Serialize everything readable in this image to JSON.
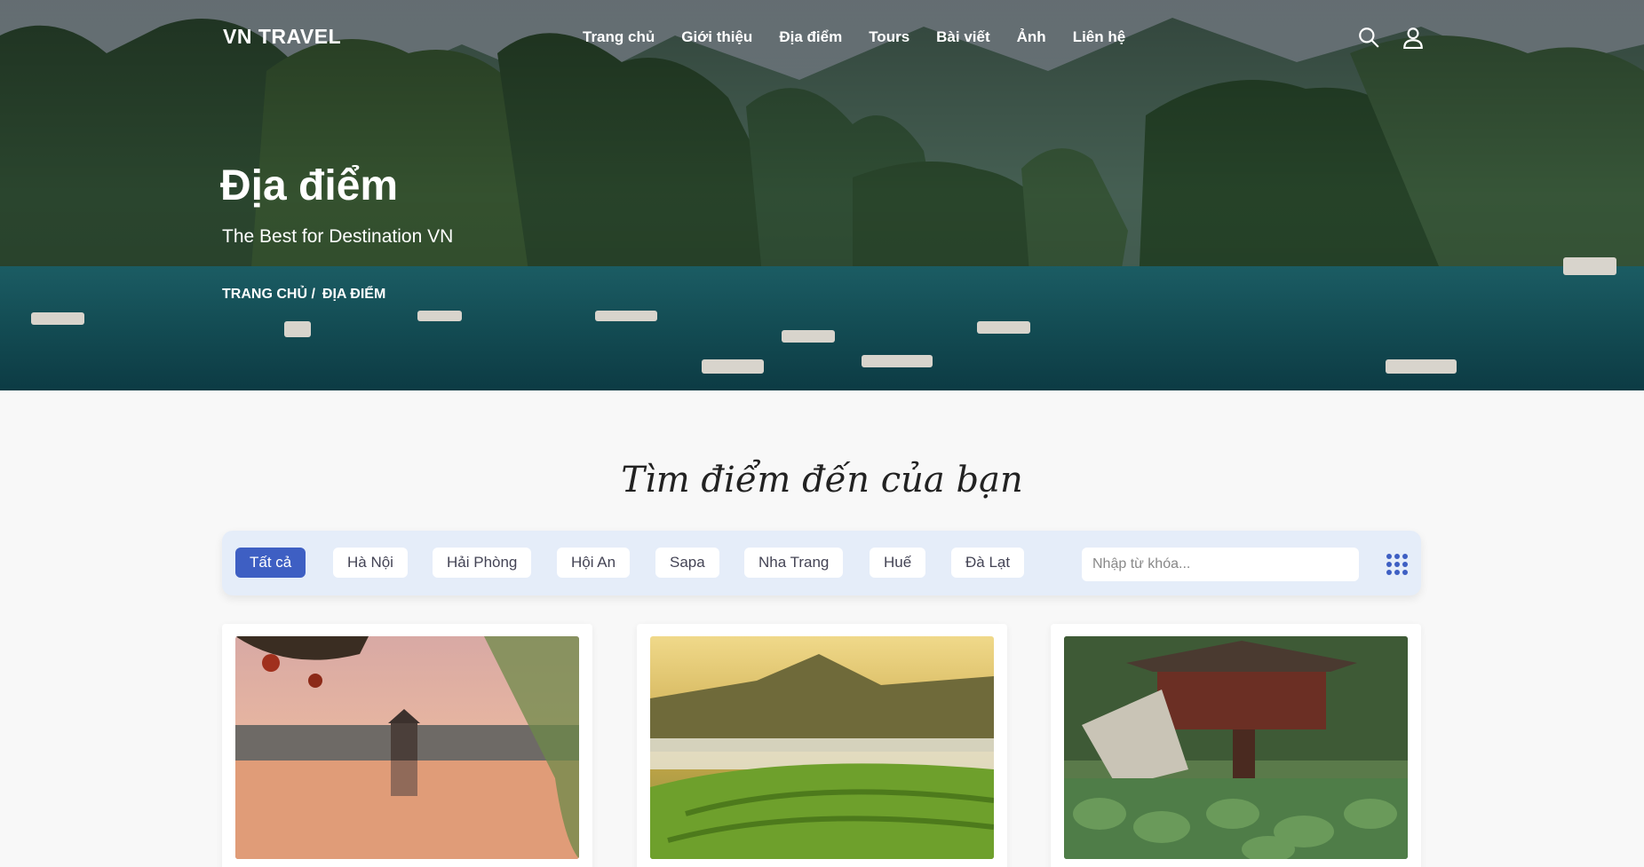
{
  "header": {
    "logo": "VN TRAVEL",
    "menu": [
      "Trang chủ",
      "Giới thiệu",
      "Địa điểm",
      "Tours",
      "Bài viết",
      "Ảnh",
      "Liên hệ"
    ],
    "icons": [
      "search-icon",
      "user-icon"
    ]
  },
  "hero": {
    "title": "Địa điểm",
    "subtitle": "The Best for Destination VN",
    "breadcrumb": [
      "TRANG CHỦ /",
      "ĐỊA ĐIỂM"
    ]
  },
  "section": {
    "title": "Tìm điểm đến của bạn"
  },
  "filters": {
    "chips": [
      "Tất cả",
      "Hà Nội",
      "Hải Phòng",
      "Hội An",
      "Sapa",
      "Nha Trang",
      "Huế",
      "Đà Lạt"
    ],
    "active": "Tất cả",
    "search_placeholder": "Nhập từ khóa...",
    "grid_icon": "grid-icon"
  },
  "cards": [
    {
      "image": "hoan-kiem-lake-photo"
    },
    {
      "image": "mountain-rice-terrace-photo"
    },
    {
      "image": "one-pillar-pagoda-photo"
    }
  ],
  "colors": {
    "accent": "#3e5fc3",
    "filter_bg": "#e5edf9",
    "page_bg": "#f8f8f8"
  }
}
